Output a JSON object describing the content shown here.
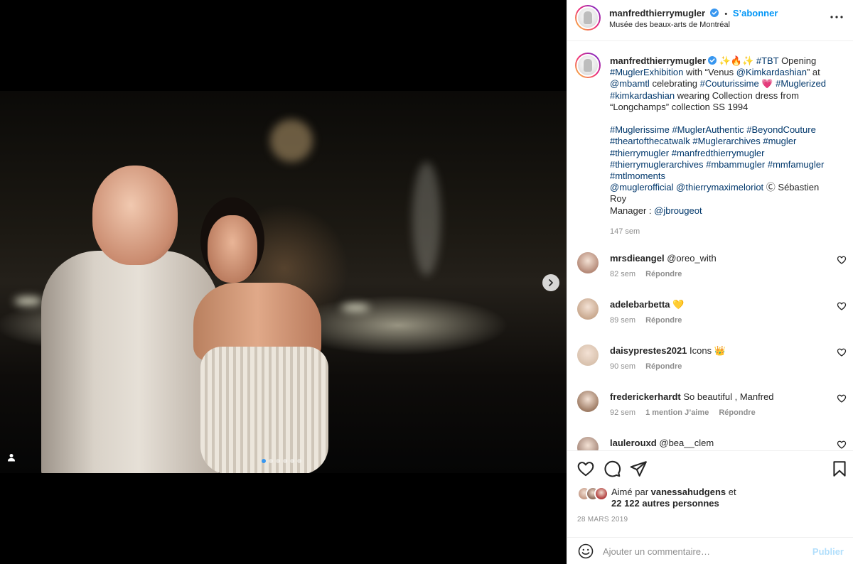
{
  "post": {
    "author": "manfredthierrymugler",
    "follow_label": "S’abonner",
    "separator": "•",
    "location": "Musée des beaux-arts de Montréal",
    "carousel": {
      "total": 6,
      "active_index": 0
    }
  },
  "caption": {
    "author": "manfredthierrymugler",
    "lines": [
      {
        "segments": [
          {
            "text": "✨🔥✨ "
          },
          {
            "text": "#TBT",
            "tag": true
          },
          {
            "text": " Opening"
          }
        ]
      },
      {
        "segments": [
          {
            "text": "#MuglerExhibition",
            "tag": true
          },
          {
            "text": " with “Venus "
          },
          {
            "text": "@Kimkardashian",
            "tag": true
          },
          {
            "text": "” at"
          }
        ]
      },
      {
        "segments": [
          {
            "text": "@mbamtl",
            "tag": true
          },
          {
            "text": " celebrating "
          },
          {
            "text": "#Couturissime",
            "tag": true
          },
          {
            "text": " 💗 "
          },
          {
            "text": "#Muglerized",
            "tag": true
          }
        ]
      },
      {
        "segments": [
          {
            "text": "#kimkardashian",
            "tag": true
          },
          {
            "text": " wearing Collection dress from"
          }
        ]
      },
      {
        "segments": [
          {
            "text": "“Longchamps” collection SS 1994"
          }
        ]
      },
      {
        "segments": []
      },
      {
        "segments": [
          {
            "text": "#Muglerissime",
            "tag": true
          },
          {
            "text": " "
          },
          {
            "text": "#MuglerAuthentic",
            "tag": true
          },
          {
            "text": " "
          },
          {
            "text": "#BeyondCouture",
            "tag": true
          }
        ]
      },
      {
        "segments": [
          {
            "text": "#theartofthecatwalk",
            "tag": true
          },
          {
            "text": " "
          },
          {
            "text": "#Muglerarchives",
            "tag": true
          },
          {
            "text": " "
          },
          {
            "text": "#mugler",
            "tag": true
          }
        ]
      },
      {
        "segments": [
          {
            "text": "#thierrymugler",
            "tag": true
          },
          {
            "text": " "
          },
          {
            "text": "#manfredthierrymugler",
            "tag": true
          }
        ]
      },
      {
        "segments": [
          {
            "text": "#thierrymuglerarchives",
            "tag": true
          },
          {
            "text": " "
          },
          {
            "text": "#mbammugler",
            "tag": true
          },
          {
            "text": " "
          },
          {
            "text": "#mmfamugler",
            "tag": true
          }
        ]
      },
      {
        "segments": [
          {
            "text": "#mtlmoments",
            "tag": true
          }
        ]
      },
      {
        "segments": [
          {
            "text": "@muglerofficial",
            "tag": true
          },
          {
            "text": " "
          },
          {
            "text": "@thierrymaximeloriot",
            "tag": true
          },
          {
            "text": " Ⓒ Sébastien"
          }
        ]
      },
      {
        "segments": [
          {
            "text": "Roy"
          }
        ]
      },
      {
        "segments": [
          {
            "text": "Manager : "
          },
          {
            "text": "@jbrougeot",
            "tag": true
          }
        ]
      }
    ],
    "time": "147 sem"
  },
  "comments": [
    {
      "user": "mrsdieangel",
      "segments": [
        {
          "text": "@oreo_with",
          "tag": true
        }
      ],
      "time": "82 sem",
      "likes": "",
      "reply": "Répondre",
      "avatar_color": "#b58a78"
    },
    {
      "user": "adelebarbetta",
      "segments": [
        {
          "text": "💛"
        }
      ],
      "time": "89 sem",
      "likes": "",
      "reply": "Répondre",
      "avatar_color": "#c9a98f"
    },
    {
      "user": "daisyprestes2021",
      "segments": [
        {
          "text": "Icons 👑"
        }
      ],
      "time": "90 sem",
      "likes": "",
      "reply": "Répondre",
      "avatar_color": "#d9c2ae"
    },
    {
      "user": "frederickerhardt",
      "segments": [
        {
          "text": "So beautiful , Manfred"
        }
      ],
      "time": "92 sem",
      "likes": "1 mention J’aime",
      "reply": "Répondre",
      "avatar_color": "#9f7d66"
    },
    {
      "user": "laulerouxd",
      "segments": [
        {
          "text": "@bea__clem",
          "tag": true
        }
      ],
      "time": "",
      "likes": "",
      "reply": "",
      "avatar_color": "#a88a7c"
    }
  ],
  "likes": {
    "prefix": "Aimé par",
    "first_user": "vanessahudgens",
    "and": "et",
    "others": "22 122 autres personnes",
    "avatar_colors": [
      "#c49a86",
      "#8f6b5a",
      "#b03a3a"
    ]
  },
  "date": "28 MARS 2019",
  "composer": {
    "placeholder": "Ajouter un commentaire…",
    "publish_label": "Publier"
  },
  "colors": {
    "accent": "#0095f6",
    "link": "#00376b",
    "muted": "#8e8e8e",
    "border": "#efefef",
    "publish_disabled": "#b2dffc"
  },
  "icons": {
    "verified": "verified-badge-icon",
    "more": "more-options-icon",
    "like": "heart-icon",
    "comment": "comment-bubble-icon",
    "share": "paper-plane-icon",
    "save": "bookmark-icon",
    "emoji": "emoji-smiley-icon",
    "next": "chevron-right-icon",
    "tags": "person-tag-icon"
  }
}
